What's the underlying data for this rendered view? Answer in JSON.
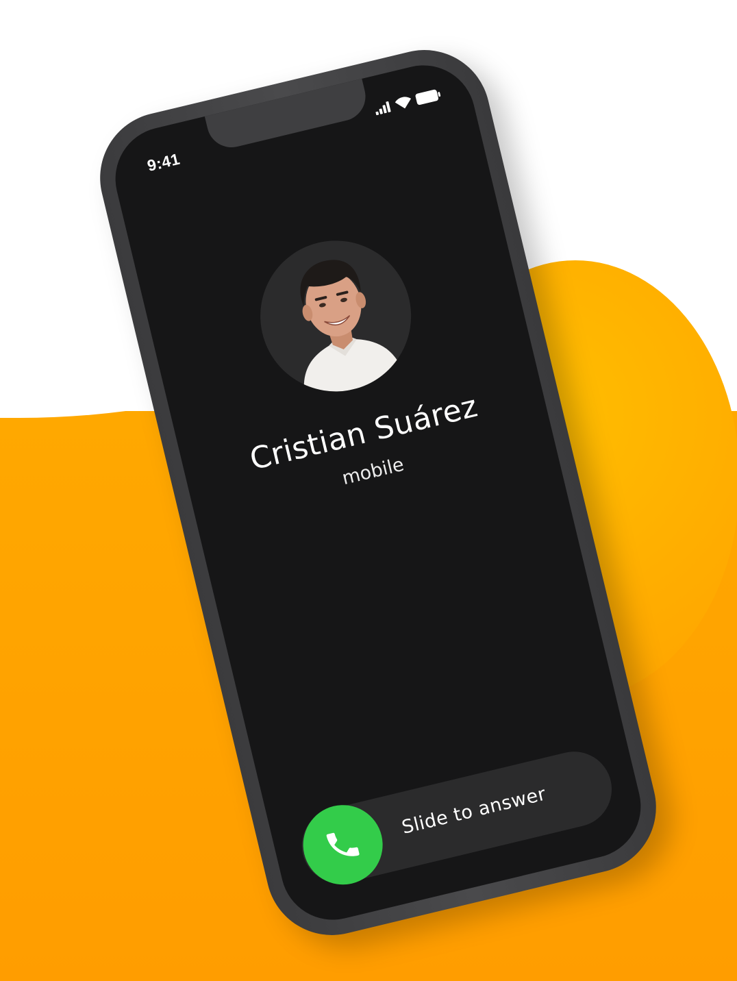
{
  "status_bar": {
    "time": "9:41",
    "icons": [
      "signal-icon",
      "wifi-icon",
      "battery-icon"
    ]
  },
  "caller": {
    "name": "Cristian Suárez",
    "label": "mobile",
    "avatar_icon": "person-photo"
  },
  "answer_control": {
    "label": "Slide to answer",
    "icon": "phone-icon"
  },
  "colors": {
    "accent_orange": "#ffa800",
    "screen_bg": "#161617",
    "answer_green": "#33cc4a",
    "slider_track": "#2b2b2c"
  }
}
